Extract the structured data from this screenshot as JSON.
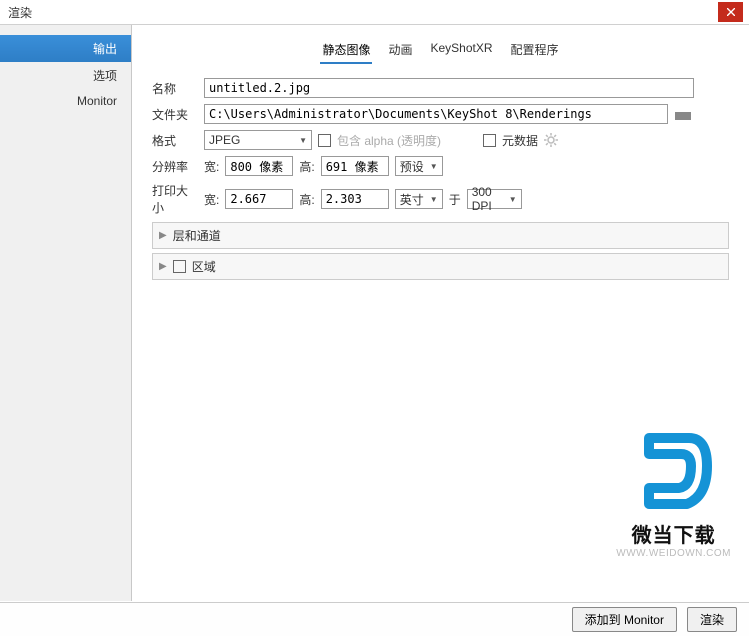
{
  "title": "渲染",
  "sidebar": {
    "items": [
      {
        "label": "输出"
      },
      {
        "label": "选项"
      },
      {
        "label": "Monitor"
      }
    ]
  },
  "tabs": [
    {
      "label": "静态图像"
    },
    {
      "label": "动画"
    },
    {
      "label": "KeyShotXR"
    },
    {
      "label": "配置程序"
    }
  ],
  "form": {
    "name_label": "名称",
    "name_value": "untitled.2.jpg",
    "folder_label": "文件夹",
    "folder_value": "C:\\Users\\Administrator\\Documents\\KeyShot 8\\Renderings",
    "format_label": "格式",
    "format_value": "JPEG",
    "alpha_label": "包含 alpha (透明度)",
    "meta_label": "元数据",
    "res_label": "分辨率",
    "width_label": "宽:",
    "height_label": "高:",
    "res_w": "800 像素",
    "res_h": "691 像素",
    "preset_label": "预设",
    "print_label": "打印大小",
    "print_w": "2.667",
    "print_h": "2.303",
    "unit": "英寸",
    "at_label": "于",
    "dpi": "300 DPI"
  },
  "sections": {
    "layers": "层和通道",
    "region": "区域"
  },
  "footer": {
    "add_monitor": "添加到 Monitor",
    "render": "渲染"
  },
  "watermark": {
    "text": "微当下载",
    "url": "WWW.WEIDOWN.COM"
  }
}
